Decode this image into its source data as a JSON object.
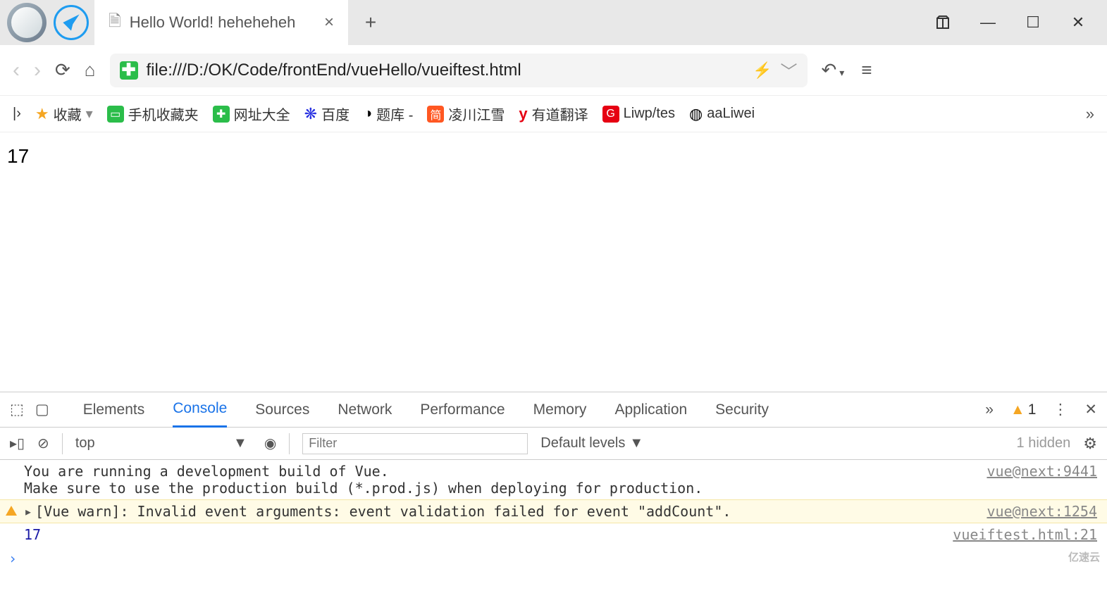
{
  "window": {
    "tab_title": "Hello World! heheheheh",
    "minimize": "—",
    "maximize": "☐",
    "close": "✕"
  },
  "addressbar": {
    "url": "file:///D:/OK/Code/frontEnd/vueHello/vueiftest.html"
  },
  "bookmarks": {
    "sniffer": "|›",
    "fav": "收藏",
    "mobile": "手机收藏夹",
    "sites": "网址大全",
    "baidu": "百度",
    "tiku": "题库 -",
    "ling": "凌川江雪",
    "youdao": "有道翻译",
    "liwp": "Liwp/tes",
    "aaliwei": "aaLiwei"
  },
  "page": {
    "content": "17"
  },
  "devtools": {
    "tabs": {
      "elements": "Elements",
      "console": "Console",
      "sources": "Sources",
      "network": "Network",
      "performance": "Performance",
      "memory": "Memory",
      "application": "Application",
      "security": "Security"
    },
    "warn_count": "1",
    "toolbar": {
      "context": "top",
      "filter_placeholder": "Filter",
      "levels": "Default levels",
      "hidden": "1 hidden"
    },
    "logs": {
      "info_msg": "You are running a development build of Vue.\nMake sure to use the production build (*.prod.js) when deploying for production.",
      "info_src": "vue@next:9441",
      "warn_msg": "[Vue warn]: Invalid event arguments: event validation failed for event \"addCount\".",
      "warn_src": "vue@next:1254",
      "num_msg": "17",
      "num_src": "vueiftest.html:21"
    },
    "prompt": "›"
  },
  "watermark": "亿速云"
}
